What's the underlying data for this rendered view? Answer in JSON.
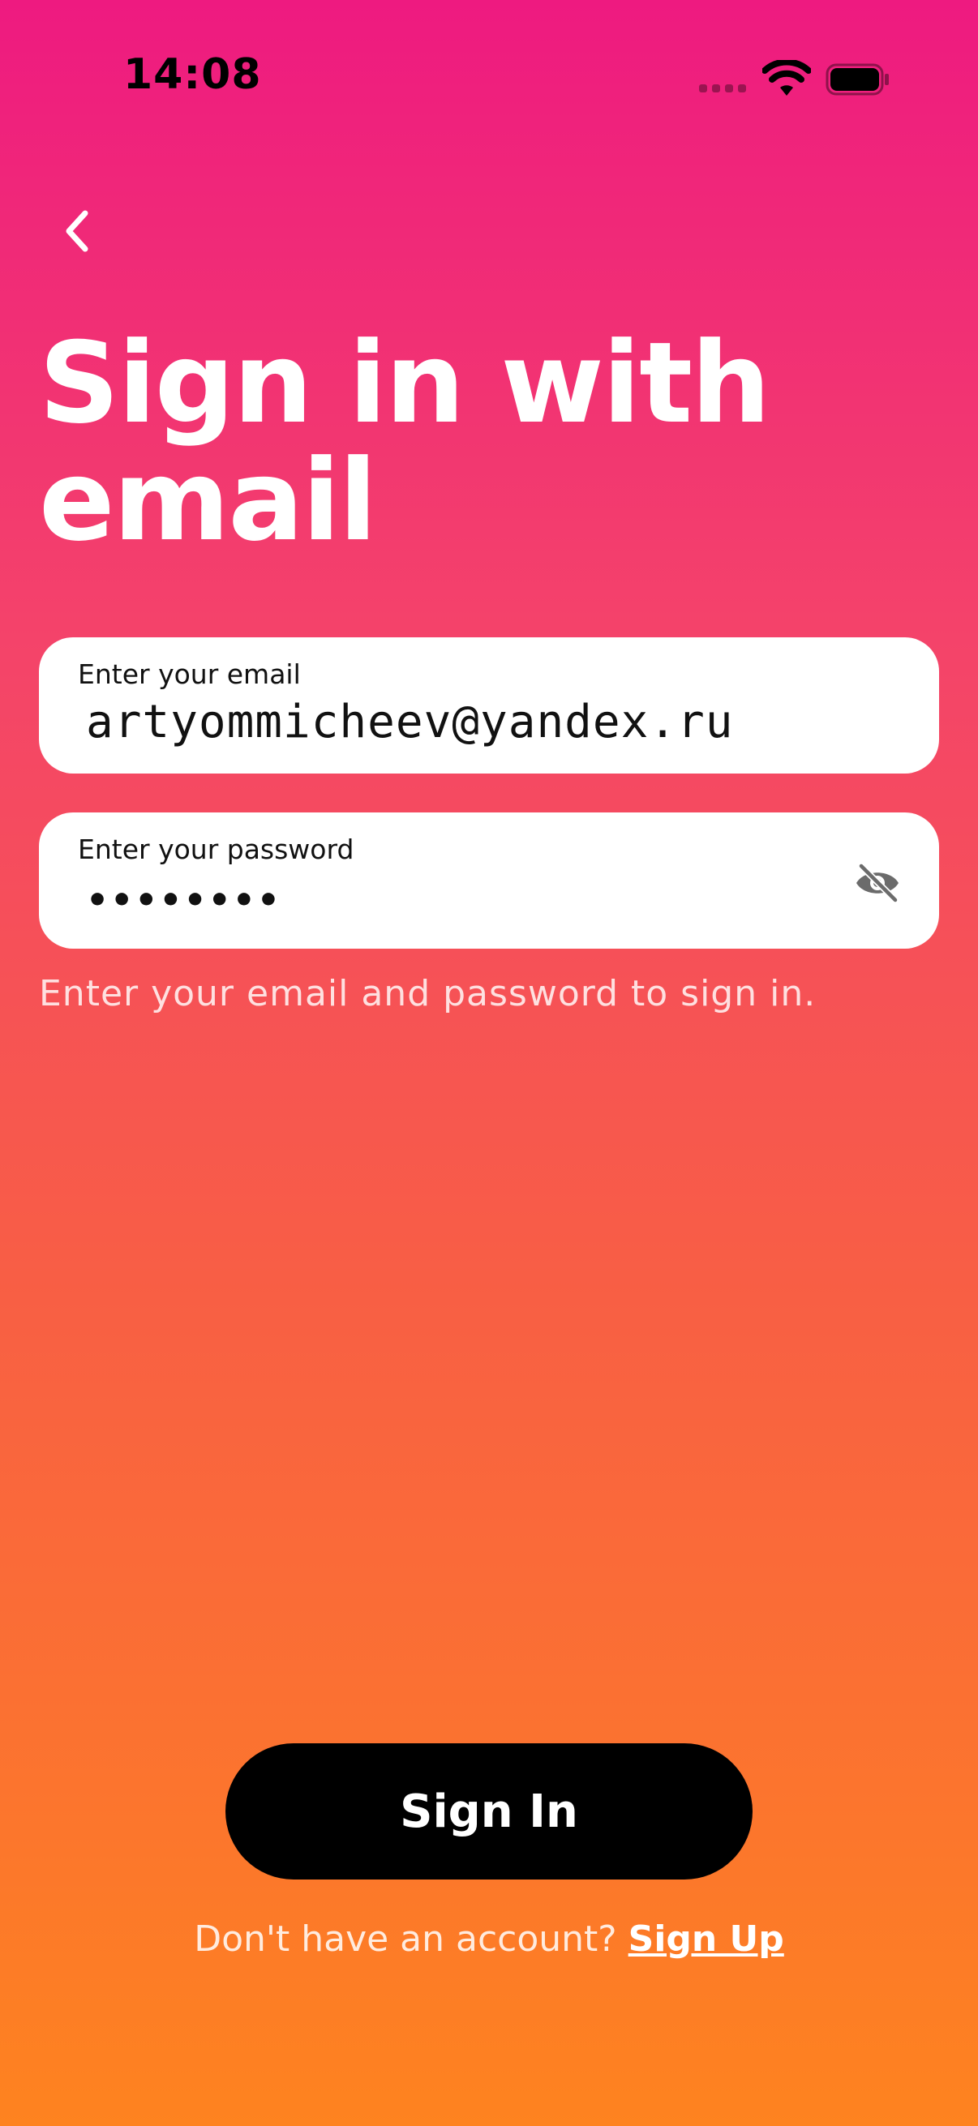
{
  "status_bar": {
    "time": "14:08"
  },
  "header": {
    "title": "Sign in with email"
  },
  "form": {
    "email": {
      "label": "Enter your email",
      "value": "artyommicheev@yandex.ru"
    },
    "password": {
      "label": "Enter your password",
      "value": "••••••••"
    },
    "hint": "Enter your email and password to sign in."
  },
  "actions": {
    "signin_label": "Sign In",
    "signup_prompt": "Don't have an account?",
    "signup_link": "Sign Up"
  },
  "icons": {
    "back": "chevron-left-icon",
    "password_visibility": "eye-off-icon",
    "wifi": "wifi-icon",
    "battery": "battery-icon"
  },
  "colors": {
    "gradient_top": "#EE1A80",
    "gradient_bottom": "#FE831F",
    "button": "#000000",
    "field_background": "#FFFFFF"
  }
}
